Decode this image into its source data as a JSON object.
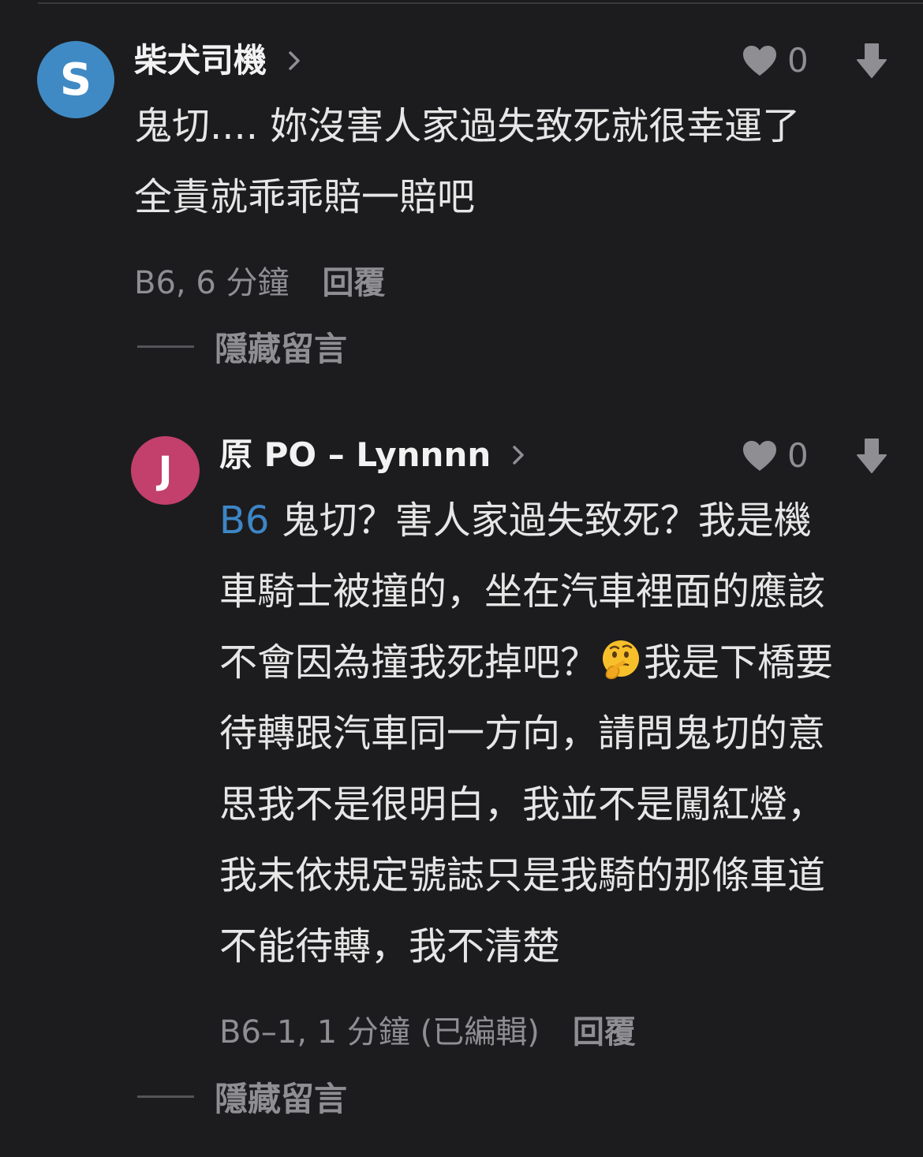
{
  "comments": [
    {
      "avatar_letter": "S",
      "avatar_color": "#3f8ac4",
      "username": "柴犬司機",
      "like_count": "0",
      "content_lines": [
        "鬼切.... 妳沒害人家過失致死就很幸運了",
        "全責就乖乖賠一賠吧"
      ],
      "meta": "B6, 6 分鐘",
      "reply_label": "回覆",
      "hide_label": "隱藏留言"
    },
    {
      "avatar_letter": "J",
      "avatar_color": "#c2406b",
      "username": "原 PO – Lynnnn",
      "like_count": "0",
      "mention": "B6",
      "content_lines": [
        "鬼切？害人家過失致死？我是機",
        "車騎士被撞的，坐在汽車裡面的應該",
        "不會因為撞我死掉吧？",
        "我是下橋要",
        "待轉跟汽車同一方向，請問鬼切的意",
        "思我不是很明白，我並不是闖紅燈，",
        "我未依規定號誌只是我騎的那條車道",
        "不能待轉，我不清楚"
      ],
      "emoji_icon": "thinking-face-icon",
      "meta": "B6–1, 1 分鐘 (已編輯)",
      "reply_label": "回覆",
      "hide_label": "隱藏留言"
    }
  ],
  "colors": {
    "background": "#1c1c1e",
    "text": "#e6e6e6",
    "muted": "#8e8e93",
    "mention": "#3d86c6"
  }
}
